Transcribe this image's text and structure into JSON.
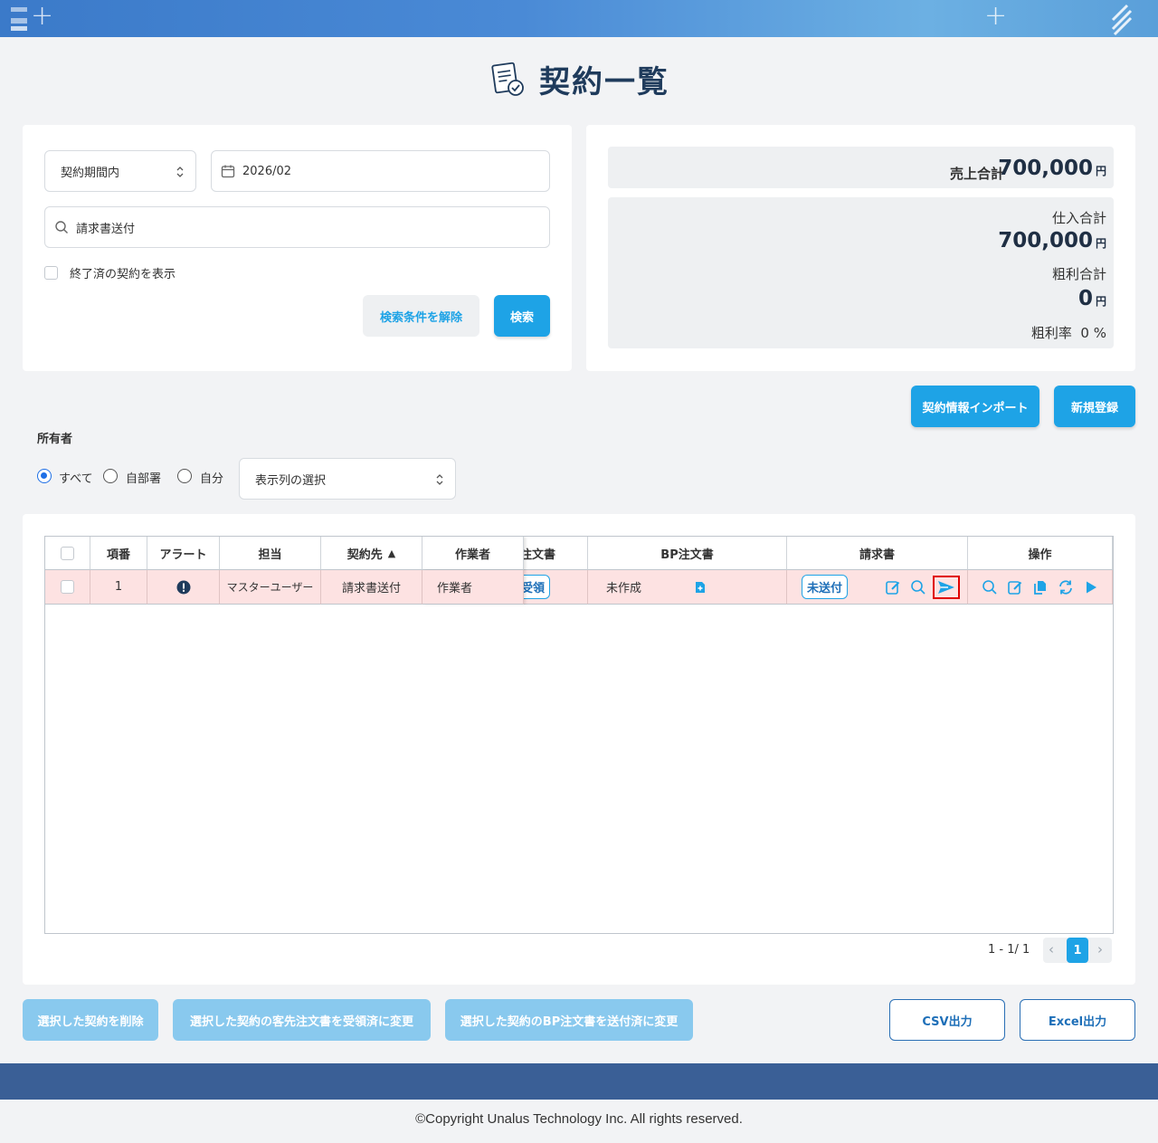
{
  "page": {
    "title": "契約一覧",
    "title_icon": "contract-document-icon"
  },
  "colors": {
    "primary": "#1ea3e6",
    "header_navy": "#3a5f96",
    "row_highlight": "#fde2e2",
    "highlight_border": "#e00000"
  },
  "search": {
    "period_select": "契約期間内",
    "month_value": "2026/02",
    "keyword_value": "請求書送付",
    "show_finished_label": "終了済の契約を表示",
    "clear_button": "検索条件を解除",
    "search_button": "検索"
  },
  "summary": {
    "sales_label": "売上合計",
    "sales_value": "700,000",
    "purchase_label": "仕入合計",
    "purchase_value": "700,000",
    "profit_label": "粗利合計",
    "profit_value": "0",
    "yen": "円",
    "margin_label": "粗利率",
    "margin_value": "0 %"
  },
  "actions": {
    "import_button": "契約情報インポート",
    "new_button": "新規登録"
  },
  "owner": {
    "label": "所有者",
    "options": [
      "すべて",
      "自部署",
      "自分"
    ],
    "selected": "すべて",
    "columns_select": "表示列の選択"
  },
  "table": {
    "headers": {
      "no": "項番",
      "alert": "アラート",
      "person": "担当",
      "client": "契約先",
      "worker": "作業者",
      "order": "注文書",
      "bp_order": "BP注文書",
      "invoice": "請求書",
      "ops": "操作"
    },
    "sort_indicator": "▲",
    "rows": [
      {
        "no": "1",
        "person": "マスターユーザー",
        "client": "請求書送付",
        "worker": "作業者",
        "order_badge": "受領",
        "bp_status": "未作成",
        "invoice_badge": "未送付"
      }
    ]
  },
  "pagination": {
    "range": "1 - 1/ 1",
    "current_page": "1"
  },
  "bottom_buttons": {
    "delete": "選択した契約を削除",
    "order_received": "選択した契約の客先注文書を受領済に変更",
    "bp_sent": "選択した契約のBP注文書を送付済に変更",
    "csv": "CSV出力",
    "excel": "Excel出力"
  },
  "footer": {
    "copyright": "©Copyright Unalus Technology Inc. All rights reserved."
  }
}
